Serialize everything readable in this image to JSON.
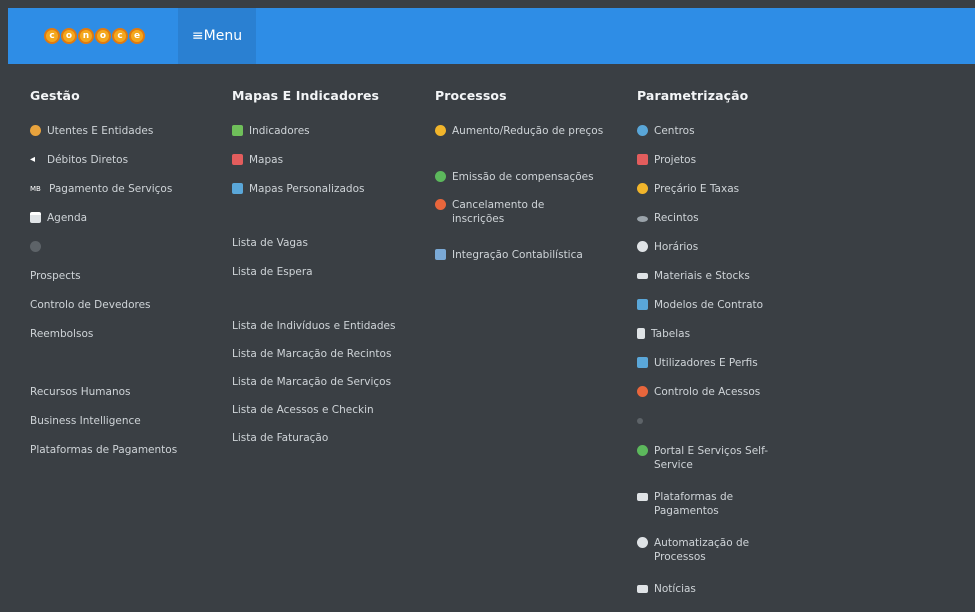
{
  "header": {
    "logo_letters": [
      "c",
      "o",
      "n",
      "o",
      "c",
      "e"
    ],
    "menu_label": "≡Menu",
    "bar_color": "#2e8de6"
  },
  "columns": [
    {
      "title": "Gestão",
      "items": [
        {
          "label": "Utentes E Entidades",
          "icon": "users-icon",
          "color": "#e8a33d"
        },
        {
          "label": "Débitos Diretos",
          "icon": "arrow-icon",
          "color": "#ffffff"
        },
        {
          "label": "Pagamento de Serviços",
          "icon": "mb-icon",
          "color": "#ffffff"
        },
        {
          "label": "Agenda",
          "icon": "calendar-icon",
          "color": "#ffffff"
        },
        {
          "label": "",
          "icon": "gear-icon",
          "color": "#5d6368"
        },
        {
          "label": "Prospects",
          "icon": "",
          "color": ""
        },
        {
          "label": "Controlo de Devedores",
          "icon": "",
          "color": ""
        },
        {
          "label": "Reembolsos",
          "icon": "",
          "color": ""
        },
        {
          "label": "",
          "icon": "",
          "color": ""
        },
        {
          "label": "Recursos Humanos",
          "icon": "",
          "color": ""
        },
        {
          "label": "Business Intelligence",
          "icon": "",
          "color": ""
        },
        {
          "label": "Plataformas de Pagamentos",
          "icon": "",
          "color": ""
        }
      ]
    },
    {
      "title": "Mapas E Indicadores",
      "items": [
        {
          "label": "Indicadores",
          "icon": "chart-icon",
          "color": "#6fbf5a"
        },
        {
          "label": "Mapas",
          "icon": "map-icon",
          "color": "#e35d5d"
        },
        {
          "label": "Mapas Personalizados",
          "icon": "monitor-icon",
          "color": "#5aa7d9"
        },
        {
          "label": "Lista de Vagas",
          "icon": "",
          "color": ""
        },
        {
          "label": "Lista de Espera",
          "icon": "",
          "color": ""
        },
        {
          "label": "Lista de Indivíduos e Entidades",
          "icon": "",
          "color": ""
        },
        {
          "label": "Lista de Marcação de Recintos",
          "icon": "",
          "color": ""
        },
        {
          "label": "Lista de Marcação de Serviços",
          "icon": "",
          "color": ""
        },
        {
          "label": "Lista de Acessos e Checkin",
          "icon": "",
          "color": ""
        },
        {
          "label": "Lista de Faturação",
          "icon": "",
          "color": ""
        }
      ]
    },
    {
      "title": "Processos",
      "items": [
        {
          "label": "Aumento/Redução de preços",
          "icon": "coin-icon",
          "color": "#f1b52b"
        },
        {
          "label": "Emissão de compensações",
          "icon": "check-icon",
          "color": "#5cb85c"
        },
        {
          "label": "Cancelamento de inscrições",
          "icon": "cancel-icon",
          "color": "#e8663c"
        },
        {
          "label": "Integração Contabilística",
          "icon": "document-icon",
          "color": "#7aa9d6"
        }
      ]
    },
    {
      "title": "Parametrização",
      "items": [
        {
          "label": "Centros",
          "icon": "globe-icon",
          "color": "#59a6d8"
        },
        {
          "label": "Projetos",
          "icon": "clipboard-icon",
          "color": "#e35d5d"
        },
        {
          "label": "Preçário E Taxas",
          "icon": "coin-icon",
          "color": "#f1b52b"
        },
        {
          "label": "Recintos",
          "icon": "field-icon",
          "color": "#9aa3aa"
        },
        {
          "label": "Horários",
          "icon": "clock-icon",
          "color": "#dfe3e6"
        },
        {
          "label": "Materiais e Stocks",
          "icon": "materials-icon",
          "color": "#dfe3e6"
        },
        {
          "label": "Modelos de Contrato",
          "icon": "contract-icon",
          "color": "#5aa7d9"
        },
        {
          "label": "Tabelas",
          "icon": "table-icon",
          "color": "#dfe3e6"
        },
        {
          "label": "Utilizadores E Perfis",
          "icon": "profiles-icon",
          "color": "#5aa7d9"
        },
        {
          "label": "Controlo de Acessos",
          "icon": "access-icon",
          "color": "#e8663c"
        },
        {
          "label": "",
          "icon": "gear-icon",
          "color": "#5d6368"
        },
        {
          "label": "Portal E Serviços Self-Service",
          "icon": "portal-icon",
          "color": "#5cb85c"
        },
        {
          "label": "Plataformas de Pagamentos",
          "icon": "payment-icon",
          "color": "#dfe3e6"
        },
        {
          "label": "Automatização de Processos",
          "icon": "cog-icon",
          "color": "#dfe3e6"
        },
        {
          "label": "Notícias",
          "icon": "news-icon",
          "color": "#dfe3e6"
        }
      ]
    }
  ]
}
